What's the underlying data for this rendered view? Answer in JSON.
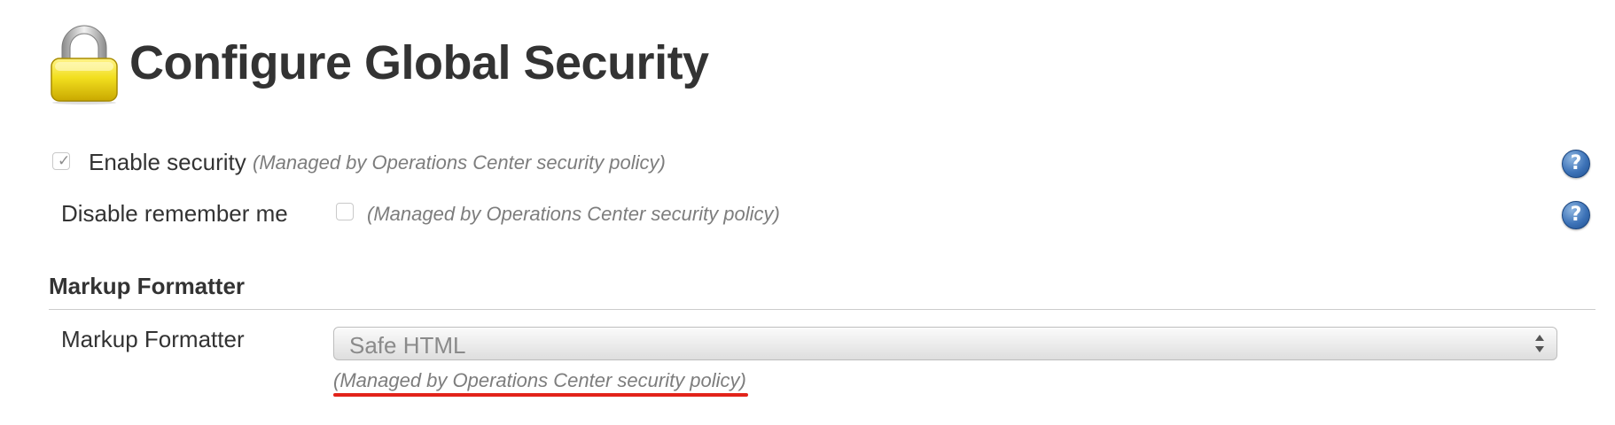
{
  "header": {
    "title": "Configure Global Security",
    "icon": "lock-icon"
  },
  "security": {
    "enable_label": "Enable security",
    "enable_checked": true,
    "enable_note": "(Managed by Operations Center security policy)",
    "disable_remember_label": "Disable remember me",
    "disable_remember_checked": false,
    "disable_remember_note": "(Managed by Operations Center security policy)",
    "help_glyph": "?"
  },
  "markup": {
    "section_title": "Markup Formatter",
    "field_label": "Markup Formatter",
    "selected_value": "Safe HTML",
    "note": "(Managed by Operations Center security policy)"
  },
  "colors": {
    "title_text": "#333333",
    "note_text": "#7d7d7d",
    "help_blue": "#3d73b8",
    "annotation_red": "#e2231a"
  }
}
